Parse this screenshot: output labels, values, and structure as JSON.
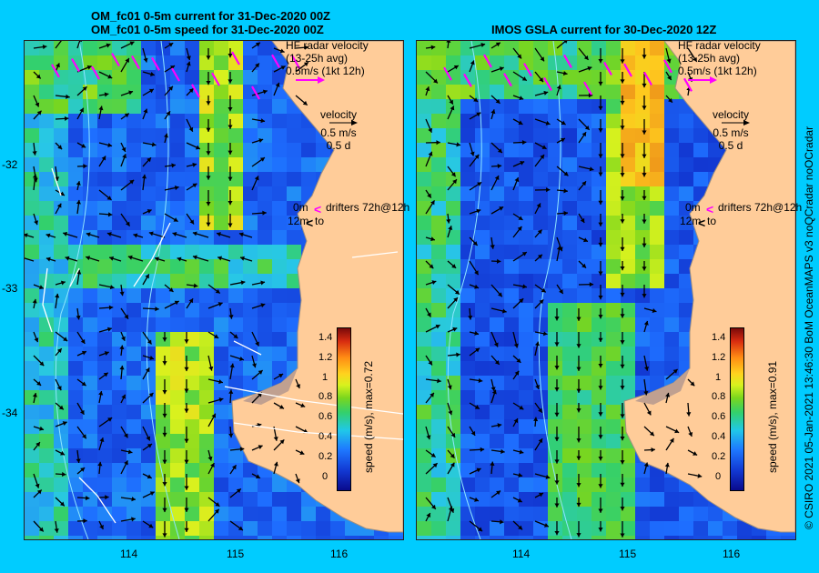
{
  "left": {
    "title1": "OM_fc01 0-5m current for 31-Dec-2020 00Z",
    "title2": "OM_fc01 0-5m speed for 31-Dec-2020 00Z",
    "colorbar_label": "speed (m/s), max=0.72"
  },
  "right": {
    "title1": "IMOS GSLA current for 30-Dec-2020 12Z",
    "colorbar_label": "speed (m/s), max=0.91"
  },
  "legend": {
    "hf1": "HF radar velocity",
    "hf2": "(13-25h avg)",
    "hf3": "0.5m/s (1kt 12h)",
    "vel1": "velocity",
    "vel2": "0.5 m/s",
    "vel3": "0.5 d",
    "dr1a": "0m",
    "dr1b": "drifters 72h@12h",
    "dr2a": "12m",
    "dr2b": "to"
  },
  "axes": {
    "y_ticks": [
      "-32",
      "-33",
      "-34"
    ],
    "x_ticks": [
      "114",
      "115",
      "116"
    ]
  },
  "colorbar_ticks": [
    "1.4",
    "1.2",
    "1",
    "0.8",
    "0.6",
    "0.4",
    "0.2",
    "0"
  ],
  "credit": "© CSIRO 2021   05-Jan-2021 13:46:30 BoM OceanMAPS v3 noQCradar noOCradar",
  "colors": {
    "background": "#00ccff",
    "land": "#ffcc99",
    "hf_radar": "#ff00ff"
  }
}
